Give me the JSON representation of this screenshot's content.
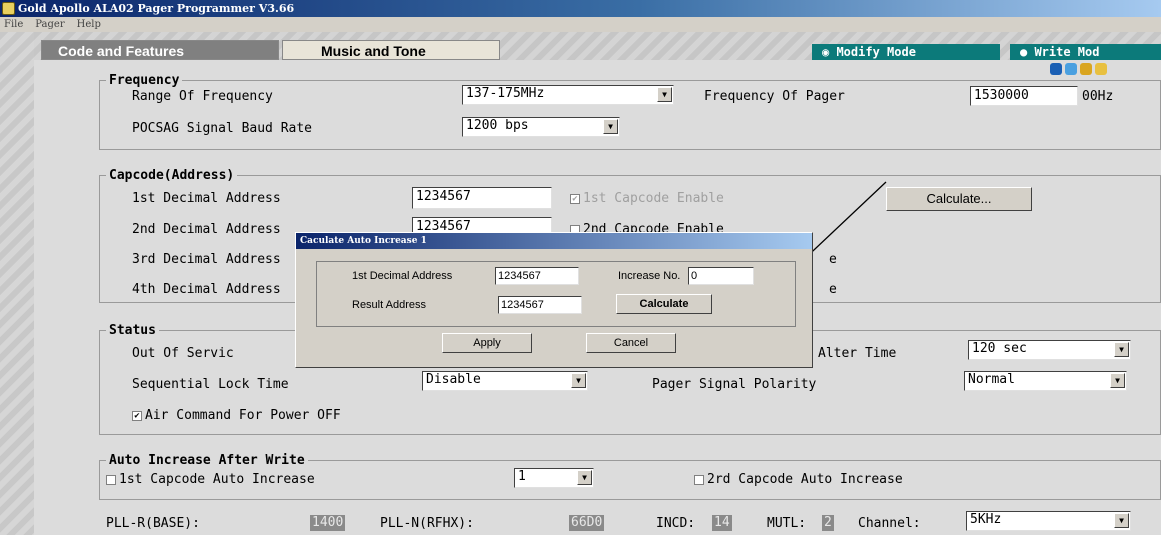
{
  "window": {
    "title": "Gold Apollo ALA02 Pager Programmer V3.66"
  },
  "menu": [
    "File",
    "Pager",
    "Help"
  ],
  "tabs": [
    {
      "label": "Code and Features",
      "active": true
    },
    {
      "label": "Music and Tone",
      "active": false
    }
  ],
  "modes": {
    "modify": "Modify Mode",
    "write": "Write Mod"
  },
  "toolbar_icons": [
    "gear-icon",
    "globe-icon",
    "tools-icon",
    "hand-icon"
  ],
  "frequency": {
    "title": "Frequency",
    "range_label": "Range Of Frequency",
    "range_value": "137-175MHz",
    "pager_freq_label": "Frequency Of Pager",
    "pager_freq_value": "1530000",
    "pager_freq_unit": "00Hz",
    "baud_label": "POCSAG Signal Baud Rate",
    "baud_value": "1200 bps"
  },
  "capcode": {
    "title": "Capcode(Address)",
    "rows": [
      {
        "label": "1st Decimal Address",
        "value": "1234567",
        "enable_label": "1st Capcode Enable",
        "checked": true
      },
      {
        "label": "2nd Decimal Address",
        "value": "1234567",
        "enable_label": "2nd Capcode Enable",
        "checked": false
      },
      {
        "label": "3rd Decimal Address",
        "value": "",
        "enable_label": "e",
        "checked": false
      },
      {
        "label": "4th Decimal Address",
        "value": "",
        "enable_label": "e",
        "checked": false
      }
    ],
    "calculate_button": "Calculate..."
  },
  "dialog": {
    "title": "Caculate Auto Increase 1",
    "first_addr_label": "1st Decimal Address",
    "first_addr_value": "1234567",
    "increase_label": "Increase No.",
    "increase_value": "0",
    "result_label": "Result Address",
    "result_value": "1234567",
    "calculate_button": "Calculate",
    "apply_button": "Apply",
    "cancel_button": "Cancel"
  },
  "status": {
    "title": "Status",
    "out_of_service_label": "Out Of Servic",
    "alter_time_label": "Alter Time",
    "alter_time_value": "120 sec",
    "seq_lock_label": "Sequential Lock Time",
    "seq_lock_value": "Disable",
    "polarity_label": "Pager Signal Polarity",
    "polarity_value": "Normal",
    "air_command_label": "Air Command For Power OFF",
    "air_command_checked": true
  },
  "auto_increase": {
    "title": "Auto Increase After Write",
    "first_label": "1st Capcode Auto Increase",
    "first_checked": false,
    "first_value": "1",
    "second_label": "2rd Capcode Auto Increase",
    "second_checked": false
  },
  "bottom": {
    "pll_r_label": "PLL-R(BASE):",
    "pll_r_value": "1400",
    "pll_n_label": "PLL-N(RFHX):",
    "pll_n_value": "66D0",
    "incd_label": "INCD:",
    "incd_value": "14",
    "mutl_label": "MUTL:",
    "mutl_value": "2",
    "channel_label": "Channel:",
    "channel_value": "5KHz"
  }
}
